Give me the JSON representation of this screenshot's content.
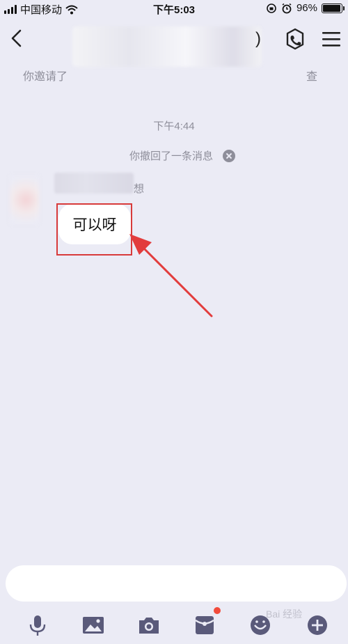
{
  "status_bar": {
    "carrier": "中国移动",
    "time": "下午5:03",
    "battery": "96%",
    "battery_level": 0.96
  },
  "nav": {
    "title_suffix": ")",
    "back_icon": "chevron-left-icon",
    "call_icon": "call-icon",
    "menu_icon": "menu-icon"
  },
  "invite_notice": {
    "left_text": "你邀请了",
    "right_text": "查"
  },
  "chat": {
    "time_divider": "下午4:44",
    "recall_notice": "你撤回了一条消息",
    "sender_name_suffix": "想",
    "message_text": "可以呀"
  },
  "toolbar": {
    "items": [
      "mic-icon",
      "image-icon",
      "camera-icon",
      "red-packet-icon",
      "emoji-icon",
      "plus-icon"
    ]
  },
  "watermark": "Bai 经验",
  "colors": {
    "background": "#ebebf5",
    "highlight": "#d83a3a",
    "badge": "#f24b3b",
    "icon": "#5a5a7a"
  }
}
